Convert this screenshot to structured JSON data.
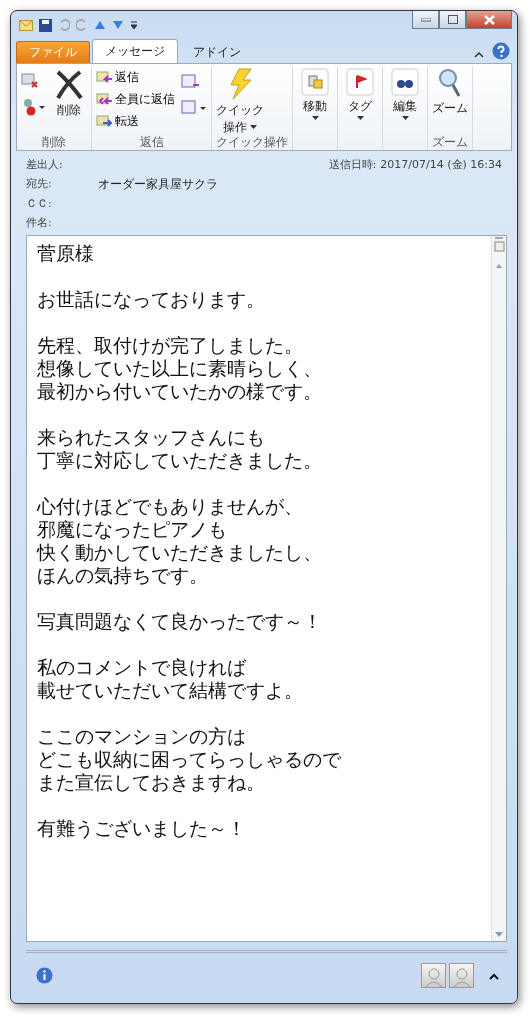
{
  "tabs": [
    {
      "label": "ファイル",
      "kind": "file",
      "selected": false
    },
    {
      "label": "メッセージ",
      "kind": "tab",
      "selected": true
    },
    {
      "label": "アドイン",
      "kind": "tab",
      "selected": false
    }
  ],
  "ribbon": [
    {
      "name": "削除",
      "buttons": [
        {
          "kind": "delete",
          "label": [
            "削除"
          ],
          "dropdown": false
        }
      ]
    },
    {
      "name": "返信",
      "buttons": [
        {
          "kind": "reply",
          "label": [
            "返信"
          ],
          "dropdown": false
        },
        {
          "kind": "replyall",
          "label": [
            "全員に返信"
          ],
          "dropdown": false
        },
        {
          "kind": "forward",
          "label": [
            "転送"
          ],
          "dropdown": false
        }
      ]
    },
    {
      "name": "クイック操作",
      "buttons": [
        {
          "kind": "quick",
          "label": [
            "クイック",
            "操作"
          ],
          "dropdown": true
        }
      ]
    },
    {
      "buttons": [
        {
          "kind": "move",
          "label": [
            "移動"
          ],
          "dropdown": true
        }
      ]
    },
    {
      "buttons": [
        {
          "kind": "tag",
          "label": [
            "タグ"
          ],
          "dropdown": true
        }
      ]
    },
    {
      "buttons": [
        {
          "kind": "edit",
          "label": [
            "編集"
          ],
          "dropdown": true
        }
      ]
    },
    {
      "name": "ズーム",
      "buttons": [
        {
          "kind": "zoom",
          "label": [
            "ズーム"
          ],
          "dropdown": false
        }
      ]
    }
  ],
  "header": {
    "from_label": "差出人:",
    "to_label": "宛先:",
    "to": "オーダー家具屋サクラ",
    "cc_label": "ＣＣ:",
    "subject_label": "件名:",
    "sent_label": "送信日時:",
    "sent": "2017/07/14 (金) 16:34"
  },
  "body": [
    [
      "菅原様"
    ],
    [
      "お世話になっております。"
    ],
    [
      "先程、取付けが完了しました。",
      "想像していた以上に素晴らしく、",
      "最初から付いていたかの様です。"
    ],
    [
      "来られたスタッフさんにも",
      "丁寧に対応していただきました。"
    ],
    [
      "心付けほどでもありませんが、",
      "邪魔になったピアノも",
      "快く動かしていただきましたし、",
      "ほんの気持ちです。"
    ],
    [
      "写真問題なくて良かったです～！"
    ],
    [
      "私のコメントで良ければ",
      "載せていただいて結構ですよ。"
    ],
    [
      "ここのマンションの方は",
      "どこも収納に困ってらっしゃるので",
      "また宣伝しておきますね。"
    ],
    [
      "有難うございました～！"
    ]
  ]
}
